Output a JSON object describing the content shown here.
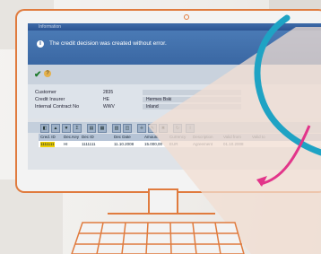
{
  "dialog": {
    "title": "Information",
    "message": "The credit decision was created without error."
  },
  "form": {
    "rows": [
      {
        "label": "Customer",
        "value": "2835",
        "field": ""
      },
      {
        "label": "Credit Insurer",
        "value": "HE",
        "field": "Hermes Bski"
      },
      {
        "label": "Internal Contract No",
        "value": "WWV",
        "field": "Inland"
      }
    ]
  },
  "table": {
    "headers": [
      "Cred. ID",
      "Dec.Key",
      "Dec ID",
      "Dec Date",
      "Amount",
      "Currency",
      "Description",
      "Valid from",
      "Valid to"
    ],
    "row": [
      "1111111",
      "HI",
      "1111111",
      "11.10.2008",
      "15.000,00",
      "EUR",
      "Agreement",
      "01.10.2008",
      ""
    ]
  },
  "colors": {
    "accent_orange": "#e07b3e",
    "teal": "#1fa3c4",
    "pink": "#e2358a",
    "dialog_blue": "#3a67a3"
  }
}
